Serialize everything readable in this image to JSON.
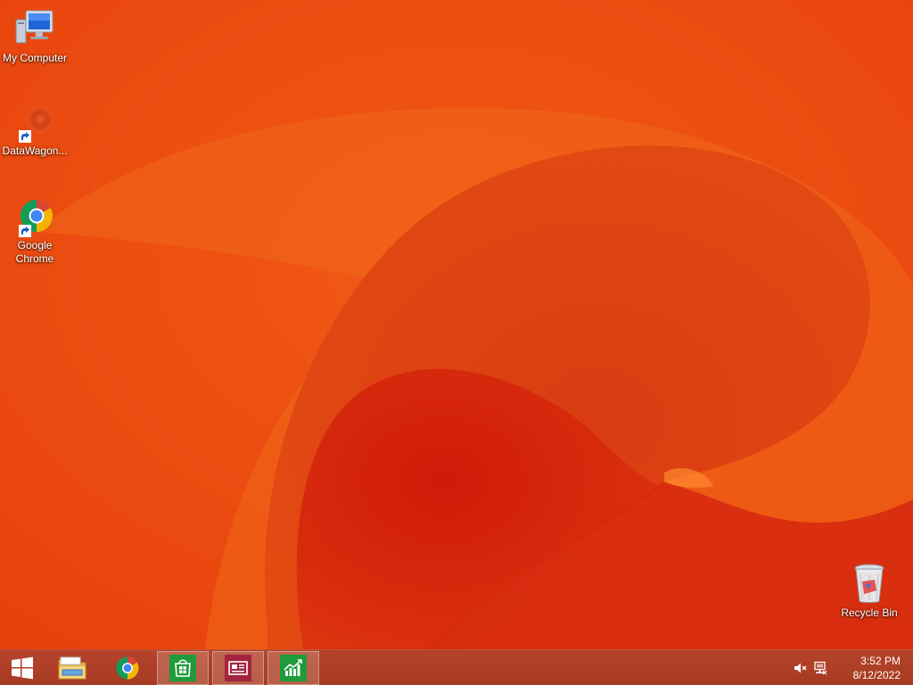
{
  "desktop": {
    "icons": [
      {
        "label": "My Computer",
        "icon": "computer-icon"
      },
      {
        "label": "DataWagon...",
        "icon": "datawagon-icon",
        "shortcut": true
      },
      {
        "label": "Google Chrome",
        "icon": "chrome-icon",
        "shortcut": true
      },
      {
        "label": "Recycle Bin",
        "icon": "recycle-bin-icon"
      }
    ]
  },
  "taskbar": {
    "start": {
      "icon": "windows-logo-icon"
    },
    "pinned": [
      {
        "name": "File Explorer",
        "icon": "folder-icon",
        "active": false
      },
      {
        "name": "Google Chrome",
        "icon": "chrome-icon",
        "active": false
      },
      {
        "name": "Store",
        "icon": "store-icon",
        "active": true,
        "color": "#1f9b3a"
      },
      {
        "name": "News",
        "icon": "news-icon",
        "active": true,
        "color": "#a3243f"
      },
      {
        "name": "Finance",
        "icon": "finance-icon",
        "active": true,
        "color": "#1f9b3a"
      }
    ],
    "tray": {
      "icons": [
        "speaker-muted-icon",
        "network-icon"
      ],
      "time": "3:52 PM",
      "date": "8/12/2022"
    }
  },
  "colors": {
    "wallpaper_base": "#e8440e",
    "taskbar": "#ab3e25"
  }
}
